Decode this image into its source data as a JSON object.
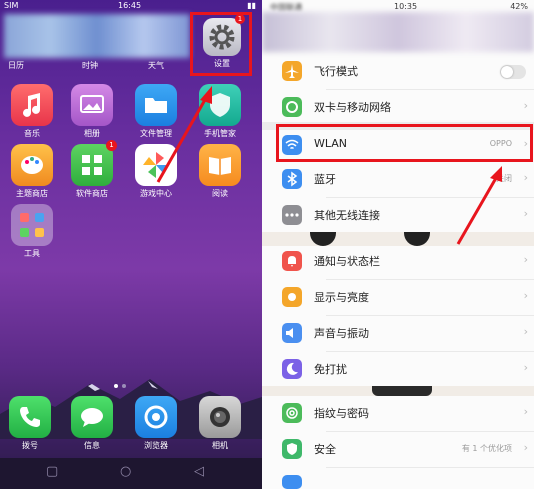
{
  "left": {
    "status": {
      "carrier": "SIM",
      "time": "16:45"
    },
    "widgets": {
      "w1": "日历",
      "w2": "时钟",
      "w3": "天气",
      "settings": "设置"
    },
    "apps_row1": [
      "音乐",
      "相册",
      "文件管理",
      "手机管家"
    ],
    "apps_row2": [
      "主题商店",
      "软件商店",
      "游戏中心",
      "阅读"
    ],
    "apps_row3": [
      "工具"
    ],
    "badges": {
      "settings": "1",
      "software_store": "1"
    },
    "dock": [
      "拨号",
      "信息",
      "浏览器",
      "相机"
    ]
  },
  "right": {
    "status": {
      "carrier": "中国联通",
      "time": "10:35",
      "battery": "42%"
    },
    "settings": {
      "airplane": "飞行模式",
      "dual_sim": "双卡与移动网络",
      "wlan": "WLAN",
      "wlan_value": "OPPO",
      "bluetooth": "蓝牙",
      "bluetooth_value": "关闭",
      "other_wireless": "其他无线连接",
      "notifications": "通知与状态栏",
      "display": "显示与亮度",
      "sound": "声音与振动",
      "dnd": "免打扰",
      "fingerprint": "指纹与密码",
      "security": "安全",
      "security_value": "有 1 个优化项"
    }
  },
  "colors": {
    "highlight_red": "#e8151d",
    "airplane_icon": "#f4a62a",
    "dual_sim_icon": "#4cbb5a",
    "wlan_icon": "#3d8ef0",
    "bluetooth_icon": "#3d8ef0",
    "other_icon": "#8e8e93",
    "notify_icon": "#f0544c",
    "display_icon": "#f4a62a",
    "sound_icon": "#4a8ff0",
    "dnd_icon": "#7b61e6",
    "fingerprint_icon": "#4cbb5a",
    "security_icon": "#3fb86a"
  }
}
